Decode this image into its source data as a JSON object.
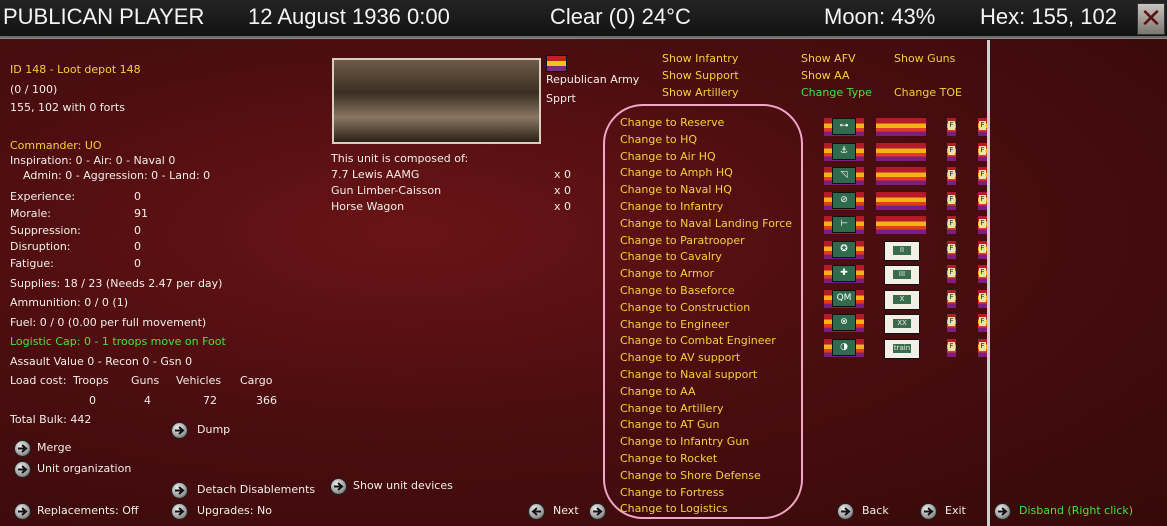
{
  "topbar": {
    "player": "PUBLICAN PLAYER",
    "date": "12 August 1936 0:00",
    "weather": "Clear (0) 24°C",
    "moon": "Moon: 43%",
    "hex": "Hex: 155, 102",
    "close_icon": "close-icon"
  },
  "unit": {
    "id_line": "ID 148 - Loot depot 148",
    "strength": "(0 / 100)",
    "location": "155, 102 with 0 forts",
    "commander": "Commander: UO",
    "inspiration": "Inspiration: 0 - Air: 0 - Naval 0",
    "admin": "Admin: 0 - Aggression: 0 - Land: 0",
    "stats": [
      {
        "label": "Experience:",
        "value": "0"
      },
      {
        "label": "Morale:",
        "value": "91"
      },
      {
        "label": "Suppression:",
        "value": "0"
      },
      {
        "label": "Disruption:",
        "value": "0"
      },
      {
        "label": "Fatigue:",
        "value": "0"
      }
    ],
    "supplies": "Supplies: 18 / 23 (Needs 2.47 per day)",
    "ammunition": "Ammunition: 0 / 0 (1)",
    "fuel": "Fuel: 0 / 0 (0.00 per full movement)",
    "logistic": "Logistic Cap: 0 - 1 troops move on Foot",
    "assault": "Assault Value 0 - Recon 0 - Gsn 0",
    "load_cost": {
      "label": "Load cost:",
      "headers": [
        "Troops",
        "Guns",
        "Vehicles",
        "Cargo"
      ],
      "values": [
        "0",
        "4",
        "72",
        "366"
      ]
    },
    "total_bulk": "Total Bulk: 442"
  },
  "left_buttons": {
    "merge": "Merge",
    "unit_org": "Unit organization",
    "dump": "Dump",
    "detach": "Detach Disablements",
    "replacements": "Replacements: Off",
    "upgrades": "Upgrades: No",
    "show_devices": "Show unit devices"
  },
  "middle": {
    "army": "Republican Army",
    "type": "Spprt",
    "composed": "This unit is composed of:",
    "devices": [
      {
        "name": "7.7 Lewis AAMG",
        "qty": "x 0"
      },
      {
        "name": "Gun Limber-Caisson",
        "qty": "x 0"
      },
      {
        "name": "Horse Wagon",
        "qty": "x 0"
      }
    ]
  },
  "show_filters": {
    "col1": [
      "Show Infantry",
      "Show Support",
      "Show Artillery"
    ],
    "col2": [
      "Show AFV",
      "Show AA"
    ],
    "col3": [
      "Show Guns"
    ],
    "change_type": "Change Type",
    "change_toe": "Change TOE"
  },
  "change_list": [
    "Change to Reserve",
    "Change to HQ",
    "Change to Air HQ",
    "Change to Amph HQ",
    "Change to Naval HQ",
    "Change to Infantry",
    "Change to Naval Landing Force",
    "Change to Paratrooper",
    "Change to Cavalry",
    "Change to Armor",
    "Change to Baseforce",
    "Change to Construction",
    "Change to Engineer",
    "Change to Combat Engineer",
    "Change to AV support",
    "Change to Naval support",
    "Change to AA",
    "Change to Artillery",
    "Change to AT Gun",
    "Change to Infantry Gun",
    "Change to Rocket",
    "Change to Shore Defense",
    "Change to Fortress",
    "Change to Logistics"
  ],
  "symbols": [
    "reserve",
    "anchor",
    "air",
    "amph",
    "naval-landing",
    "cavalry",
    "medical",
    "qm",
    "engineer",
    "armor-support"
  ],
  "toe_badges": [
    "II",
    "III",
    "X",
    "XX",
    "train"
  ],
  "badge_letter": "F",
  "bottom_nav": {
    "next": "Next",
    "back": "Back",
    "exit": "Exit",
    "disband": "Disband (Right click)"
  }
}
